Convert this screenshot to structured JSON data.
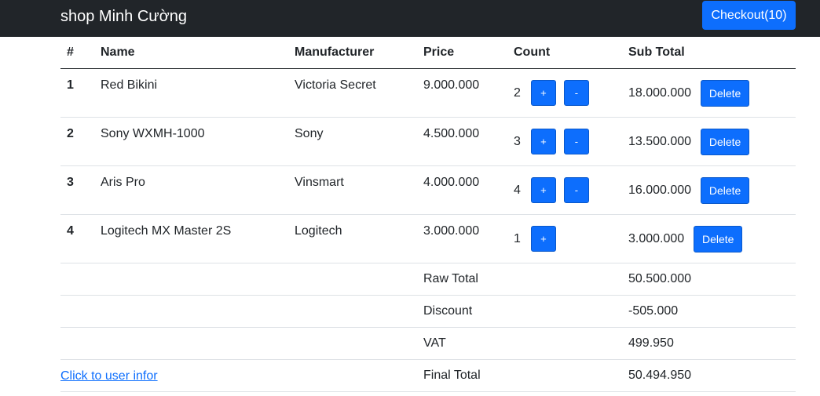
{
  "navbar": {
    "brand": "shop Minh Cường",
    "checkout_label": "Checkout(10)"
  },
  "table": {
    "headers": [
      "#",
      "Name",
      "Manufacturer",
      "Price",
      "Count",
      "Sub Total"
    ],
    "rows": [
      {
        "idx": "1",
        "name": "Red Bikini",
        "manufacturer": "Victoria Secret",
        "price": "9.000.000",
        "count": "2",
        "subtotal": "18.000.000",
        "plus": "+",
        "minus": "-",
        "delete": "Delete"
      },
      {
        "idx": "2",
        "name": "Sony WXMH-1000",
        "manufacturer": "Sony",
        "price": "4.500.000",
        "count": "3",
        "subtotal": "13.500.000",
        "plus": "+",
        "minus": "-",
        "delete": "Delete"
      },
      {
        "idx": "3",
        "name": "Aris Pro",
        "manufacturer": "Vinsmart",
        "price": "4.000.000",
        "count": "4",
        "subtotal": "16.000.000",
        "plus": "+",
        "minus": "-",
        "delete": "Delete"
      },
      {
        "idx": "4",
        "name": "Logitech MX Master 2S",
        "manufacturer": "Logitech",
        "price": "3.000.000",
        "count": "1",
        "subtotal": "3.000.000",
        "plus": "+",
        "delete": "Delete"
      }
    ],
    "summary": [
      {
        "label": "Raw Total",
        "value": "50.500.000"
      },
      {
        "label": "Discount",
        "value": "-505.000"
      },
      {
        "label": "VAT",
        "value": "499.950"
      },
      {
        "label": "Final Total",
        "value": "50.494.950"
      }
    ]
  },
  "footer": {
    "link_label": "Click to user infor"
  },
  "colors": {
    "navbar_bg": "#212529",
    "primary": "#0d6efd"
  }
}
